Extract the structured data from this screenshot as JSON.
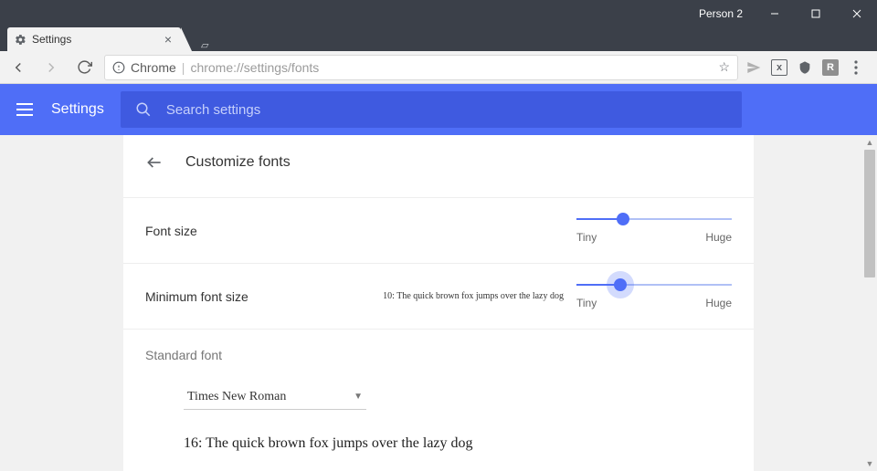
{
  "window": {
    "profile_label": "Person 2"
  },
  "tab": {
    "title": "Settings"
  },
  "address": {
    "secure_label": "Chrome",
    "url": "chrome://settings/fonts"
  },
  "header": {
    "title": "Settings",
    "search_placeholder": "Search settings"
  },
  "page": {
    "title": "Customize fonts",
    "font_size": {
      "label": "Font size",
      "min_label": "Tiny",
      "max_label": "Huge",
      "percent": 30
    },
    "min_font_size": {
      "label": "Minimum font size",
      "preview": "10: The quick brown fox jumps over the lazy dog",
      "min_label": "Tiny",
      "max_label": "Huge",
      "percent": 28
    },
    "standard_font": {
      "section_label": "Standard font",
      "selected": "Times New Roman",
      "preview": "16: The quick brown fox jumps over the lazy dog"
    }
  }
}
